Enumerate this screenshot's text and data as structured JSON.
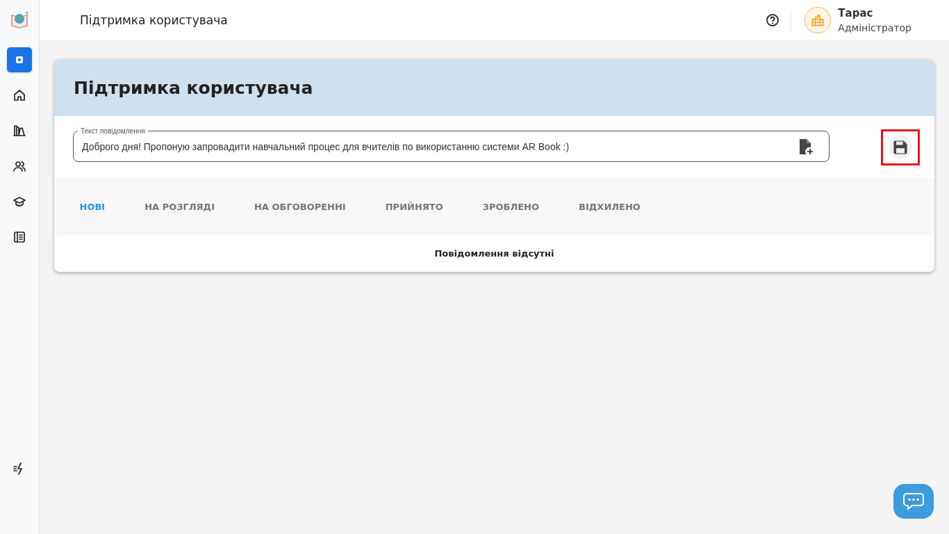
{
  "sidebar": {
    "items": [
      {
        "selected": true
      },
      {
        "selected": false
      },
      {
        "selected": false
      },
      {
        "selected": false
      },
      {
        "selected": false
      },
      {
        "selected": false
      }
    ]
  },
  "header": {
    "title": "Підтримка користувача",
    "user": {
      "name": "Тарас",
      "role": "Адміністратор"
    }
  },
  "card": {
    "title": "Підтримка користувача",
    "message_field": {
      "label": "Текст повідомлення",
      "value": "Доброго дня! Пропоную запровадити навчальний процес для вчителів по використанню системи AR Book :)"
    },
    "save_button": {
      "highlighted": true
    },
    "tabs": [
      {
        "label": "НОВІ",
        "selected": true
      },
      {
        "label": "НА РОЗГЛЯДІ",
        "selected": false
      },
      {
        "label": "НА ОБГОВОРЕННІ",
        "selected": false
      },
      {
        "label": "ПРИЙНЯТО",
        "selected": false
      },
      {
        "label": "ЗРОБЛЕНО",
        "selected": false
      },
      {
        "label": "ВІДХИЛЕНО",
        "selected": false
      }
    ],
    "empty_message": "Повідомлення відсутні"
  }
}
